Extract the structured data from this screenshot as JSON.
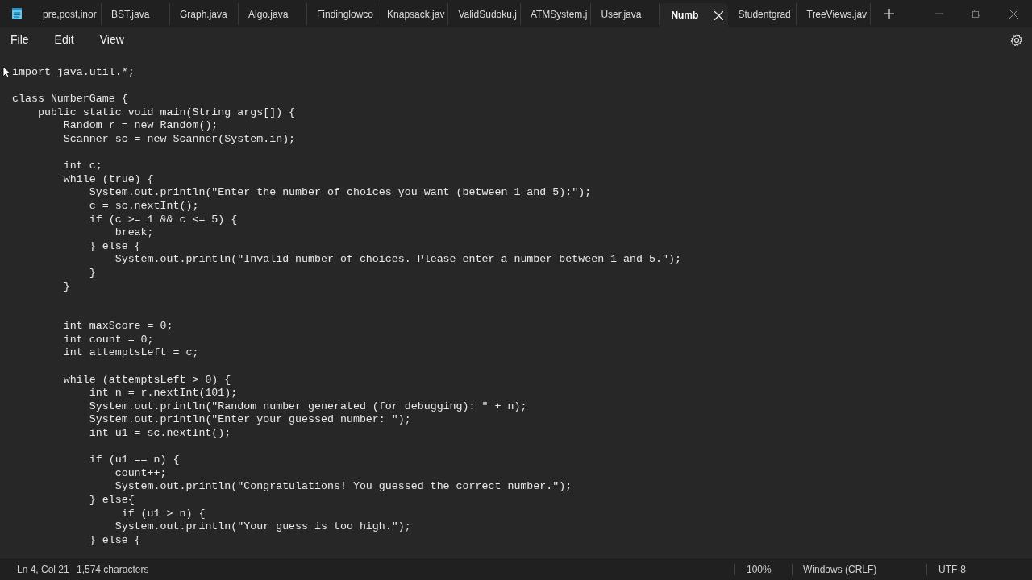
{
  "tabs": [
    {
      "label": "pre,post,inor",
      "selected": false
    },
    {
      "label": "BST.java",
      "selected": false
    },
    {
      "label": "Graph.java",
      "selected": false
    },
    {
      "label": "Algo.java",
      "selected": false
    },
    {
      "label": "Findinglowco",
      "selected": false
    },
    {
      "label": "Knapsack.jav",
      "selected": false
    },
    {
      "label": "ValidSudoku.j",
      "selected": false
    },
    {
      "label": "ATMSystem.j",
      "selected": false
    },
    {
      "label": "User.java",
      "selected": false
    },
    {
      "label": "Numb",
      "selected": true
    },
    {
      "label": "Studentgrad",
      "selected": false
    },
    {
      "label": "TreeViews.jav",
      "selected": false
    }
  ],
  "menu": [
    "File",
    "Edit",
    "View"
  ],
  "editor": {
    "blocks": [
      {
        "lines": [
          "import java.util.*;"
        ]
      },
      {
        "lines": [
          "class NumberGame {",
          "    public static void main(String args[]) {",
          "        Random r = new Random();",
          "        Scanner sc = new Scanner(System.in);"
        ]
      },
      {
        "lines": [
          "        int c;",
          "        while (true) {",
          "            System.out.println(\"Enter the number of choices you want (between 1 and 5):\");",
          "            c = sc.nextInt();",
          "            if (c >= 1 && c <= 5) {",
          "                break;",
          "            } else {",
          "                System.out.println(\"Invalid number of choices. Please enter a number between 1 and 5.\");",
          "            }",
          "        }"
        ]
      },
      {
        "lines": [
          "        int maxScore = 0;",
          "        int count = 0;",
          "        int attemptsLeft = c;"
        ]
      },
      {
        "lines": [
          "        while (attemptsLeft > 0) {",
          "            int n = r.nextInt(101);",
          "            System.out.println(\"Random number generated (for debugging): \" + n);",
          "            System.out.println(\"Enter your guessed number: \");",
          "            int u1 = sc.nextInt();"
        ]
      },
      {
        "lines": [
          "            if (u1 == n) {",
          "                count++;",
          "                System.out.println(\"Congratulations! You guessed the correct number.\");",
          "            } else{",
          "                 if (u1 > n) {",
          "                System.out.println(\"Your guess is too high.\");",
          "            } else {"
        ]
      }
    ]
  },
  "status_bar": {
    "position": "Ln 4, Col 21",
    "characters": "1,574 characters",
    "zoom": "100%",
    "line_ending": "Windows (CRLF)",
    "encoding": "UTF-8"
  }
}
